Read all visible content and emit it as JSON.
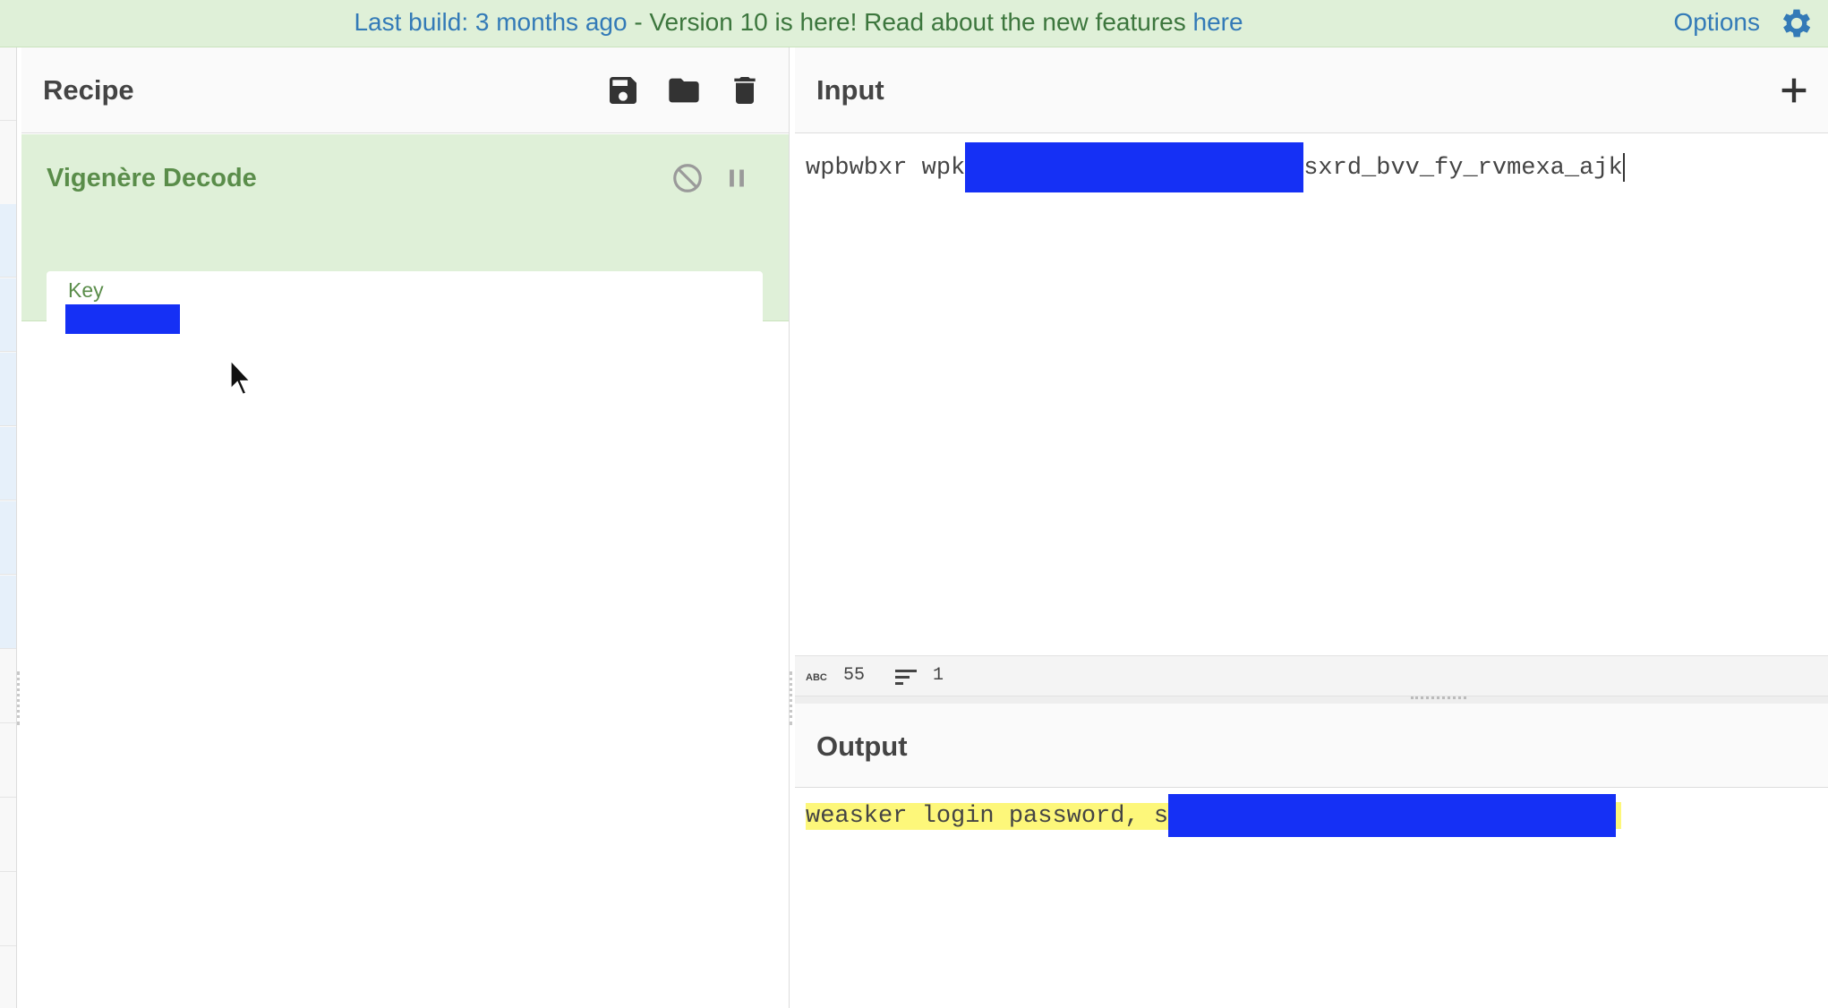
{
  "banner": {
    "last_build": "Last build: 3 months ago",
    "message": " - Version 10 is here! Read about the new features ",
    "link": "here",
    "options_label": "Options"
  },
  "recipe": {
    "title": "Recipe",
    "operation": {
      "name": "Vigenère Decode",
      "key_label": "Key"
    }
  },
  "input": {
    "title": "Input",
    "text_start": "wpbwbxr wpk",
    "text_end": "sxrd_bvv_fy_rvmexa_ajk",
    "char_count": "55",
    "line_count": "1"
  },
  "output": {
    "title": "Output",
    "text_start": "weasker login password, s"
  },
  "colors": {
    "banner_bg": "#dff0d8",
    "op_bg": "#dff0d8",
    "redaction": "#1530f5",
    "output_highlight": "#fdf77a",
    "link": "#337ab7"
  }
}
